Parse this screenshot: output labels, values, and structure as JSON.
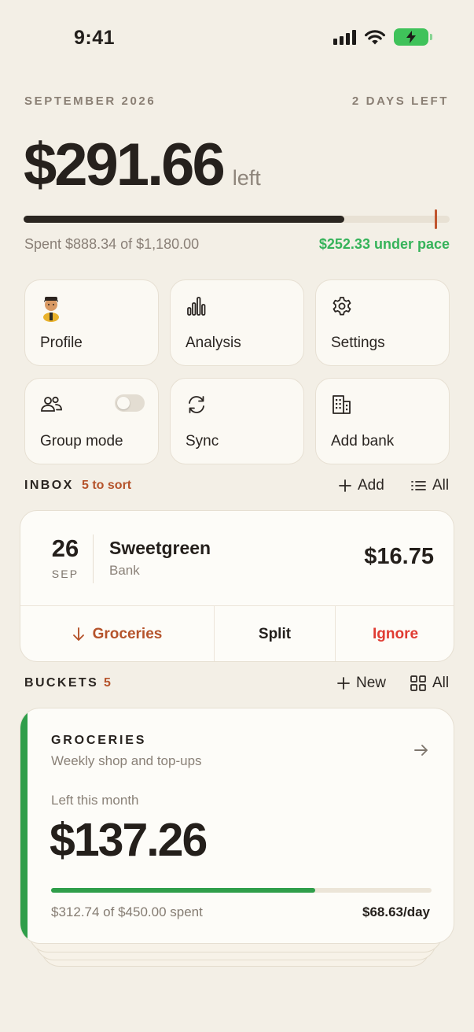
{
  "status_bar": {
    "time": "9:41",
    "battery_color": "#3fc25a"
  },
  "header": {
    "period": "SEPTEMBER 2026",
    "days_left": "2 DAYS LEFT",
    "amount": "$291.66",
    "amount_suffix": "left",
    "budget_progress": 0.753,
    "spent_text": "Spent $888.34 of $1,180.00",
    "pace_text": "$252.33 under pace",
    "pace_color": "#36b35a"
  },
  "tiles": [
    {
      "label": "Profile",
      "icon": "avatar-icon"
    },
    {
      "label": "Analysis",
      "icon": "bar-chart-icon"
    },
    {
      "label": "Settings",
      "icon": "gear-icon"
    },
    {
      "label": "Group mode",
      "icon": "people-icon",
      "toggle_on": false
    },
    {
      "label": "Sync",
      "icon": "sync-icon"
    },
    {
      "label": "Add bank",
      "icon": "building-icon"
    }
  ],
  "inbox": {
    "title": "INBOX",
    "count_text": "5 to sort",
    "add_label": "Add",
    "all_label": "All",
    "transaction": {
      "day": "26",
      "month": "SEP",
      "merchant": "Sweetgreen",
      "source": "Bank",
      "amount": "$16.75"
    },
    "actions": {
      "category": "Groceries",
      "split": "Split",
      "ignore": "Ignore"
    }
  },
  "buckets": {
    "title": "BUCKETS",
    "count": "5",
    "new_label": "New",
    "all_label": "All",
    "card": {
      "name": "GROCERIES",
      "description": "Weekly shop and top-ups",
      "left_label": "Left this month",
      "amount_left": "$137.26",
      "progress": 0.695,
      "spent_text": "$312.74 of $450.00 spent",
      "daily_text": "$68.63/day",
      "accent_color": "#2f9e4a"
    }
  },
  "colors": {
    "accent_orange": "#b5532b",
    "ignore_red": "#e03b32",
    "background": "#f3efe6"
  }
}
